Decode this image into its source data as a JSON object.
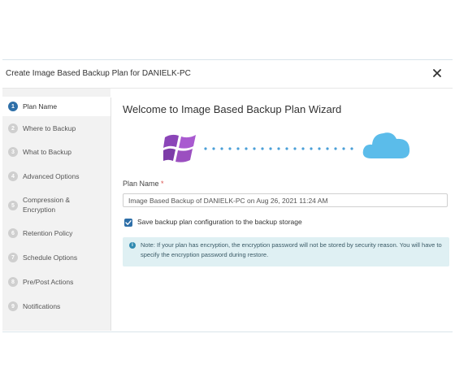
{
  "dialog": {
    "title": "Create Image Based Backup Plan for DANIELK-PC",
    "close_icon": "close-icon"
  },
  "steps": [
    {
      "num": "1",
      "label": "Plan Name",
      "active": true
    },
    {
      "num": "2",
      "label": "Where to Backup"
    },
    {
      "num": "3",
      "label": "What to Backup"
    },
    {
      "num": "4",
      "label": "Advanced Options"
    },
    {
      "num": "5",
      "label": "Compression & Encryption"
    },
    {
      "num": "6",
      "label": "Retention Policy"
    },
    {
      "num": "7",
      "label": "Schedule Options"
    },
    {
      "num": "8",
      "label": "Pre/Post Actions"
    },
    {
      "num": "9",
      "label": "Notifications"
    }
  ],
  "main": {
    "wizard_title": "Welcome to Image Based Backup Plan Wizard",
    "illustration": {
      "left_icon": "windows-logo-icon",
      "right_icon": "cloud-icon"
    },
    "plan_name_label": "Plan Name",
    "required_mark": "*",
    "plan_name_value": "Image Based Backup of DANIELK-PC on Aug 26, 2021 11:24 AM",
    "save_config_label": "Save backup plan configuration to the backup storage",
    "save_config_checked": true,
    "note_icon": "info-icon",
    "note_text": "Note: If your plan has encryption, the encryption password will not be stored by security reason. You will have to specify the encryption password during restore."
  },
  "colors": {
    "accent": "#2e6fa8",
    "windows_logo": "#9b4fc0",
    "cloud": "#5bbcea",
    "note_bg": "#dff0f3"
  }
}
